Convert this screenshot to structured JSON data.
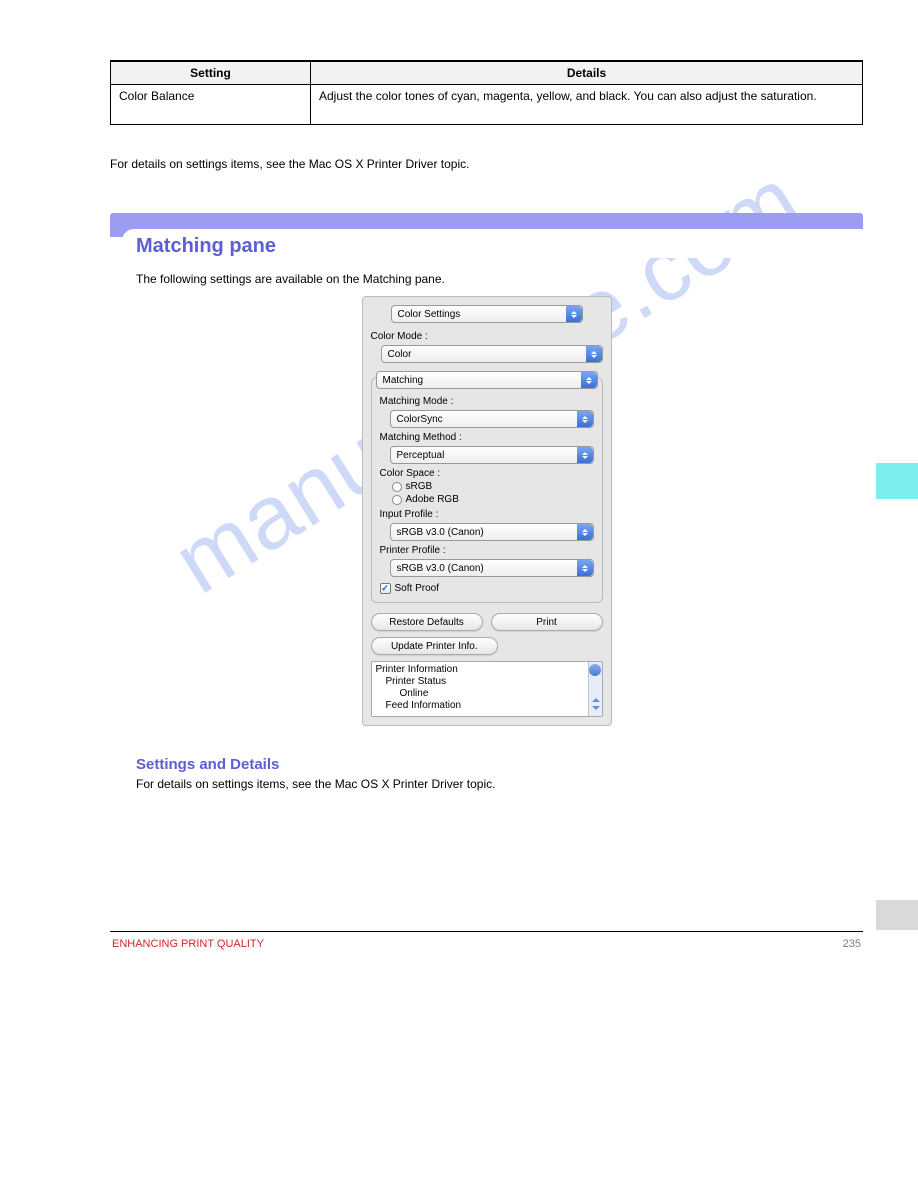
{
  "table": {
    "headers": [
      "Setting",
      "Details"
    ],
    "rows": [
      {
        "setting": "Color Balance",
        "details": "Adjust the color tones of cyan, magenta, yellow, and black. You can also adjust the saturation."
      }
    ]
  },
  "note": "For details on settings items, see the Mac OS X Printer Driver topic.",
  "heading": {
    "title": "Matching pane",
    "sub": "The following settings are available on the Matching pane."
  },
  "dialog": {
    "top_select": "Color Settings",
    "color_mode_label": "Color Mode :",
    "color_mode_value": "Color",
    "tab_value": "Matching",
    "matching_mode_label": "Matching Mode :",
    "matching_mode_value": "ColorSync",
    "matching_method_label": "Matching Method :",
    "matching_method_value": "Perceptual",
    "color_space_label": "Color Space :",
    "radio1": "sRGB",
    "radio2": "Adobe RGB",
    "input_profile_label": "Input Profile :",
    "input_profile_value": "sRGB v3.0 (Canon)",
    "printer_profile_label": "Printer Profile :",
    "printer_profile_value": "sRGB v3.0 (Canon)",
    "soft_proof": "Soft Proof",
    "btn_restore": "Restore Defaults",
    "btn_print": "Print",
    "btn_update": "Update Printer Info.",
    "info1": "Printer Information",
    "info2": "Printer Status",
    "info3": "Online",
    "info4": "Feed Information"
  },
  "settings": {
    "title": "Settings and Details",
    "desc": "For details on settings items, see the Mac OS X Printer Driver topic."
  },
  "footer": {
    "left": "ENHANCING PRINT QUALITY",
    "right": "235"
  },
  "watermark": "manualshive.com"
}
